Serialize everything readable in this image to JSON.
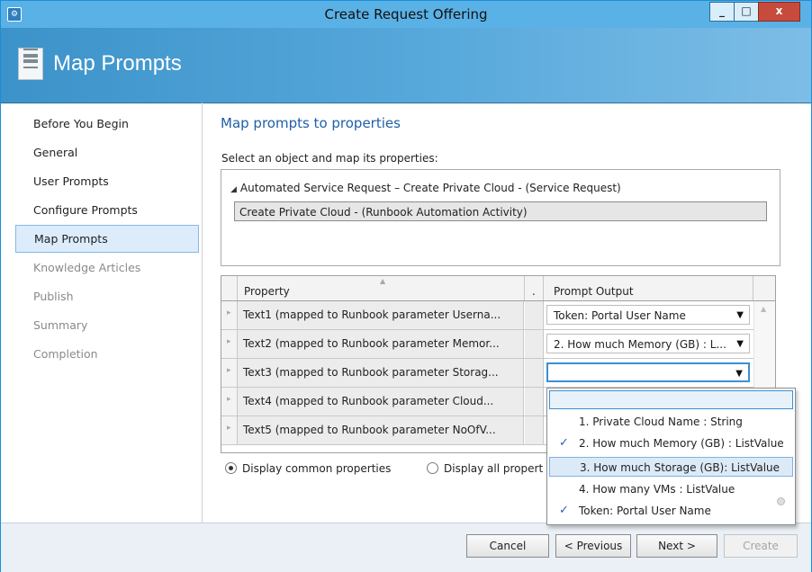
{
  "window": {
    "title": "Create Request Offering",
    "app_icon": "service-manager-icon",
    "controls": {
      "minimize": "_",
      "maximize": "□",
      "close": "x"
    }
  },
  "banner": {
    "title": "Map Prompts",
    "icon": "page-document-icon"
  },
  "nav": {
    "items": [
      {
        "label": "Before You Begin",
        "state": "normal"
      },
      {
        "label": "General",
        "state": "normal"
      },
      {
        "label": "User Prompts",
        "state": "normal"
      },
      {
        "label": "Configure Prompts",
        "state": "normal"
      },
      {
        "label": "Map Prompts",
        "state": "active"
      },
      {
        "label": "Knowledge Articles",
        "state": "disabled"
      },
      {
        "label": "Publish",
        "state": "disabled"
      },
      {
        "label": "Summary",
        "state": "disabled"
      },
      {
        "label": "Completion",
        "state": "disabled"
      }
    ]
  },
  "main": {
    "title": "Map prompts to properties",
    "instruction": "Select an object and map its properties:",
    "tree": {
      "root": "Automated Service Request – Create Private Cloud  - (Service Request)",
      "child": "Create Private Cloud - (Runbook Automation Activity)"
    },
    "grid": {
      "headers": {
        "property": "Property",
        "dot": ".",
        "output": "Prompt Output"
      },
      "rows": [
        {
          "property": "Text1 (mapped to Runbook parameter Userna...",
          "output": "Token: Portal User Name"
        },
        {
          "property": "Text2 (mapped to Runbook parameter Memor...",
          "output": "2. How much Memory (GB) : L..."
        },
        {
          "property": "Text3 (mapped to Runbook parameter Storag...",
          "output": ""
        },
        {
          "property": "Text4 (mapped to Runbook parameter Cloud...",
          "output": ""
        },
        {
          "property": "Text5 (mapped to Runbook parameter NoOfV...",
          "output": ""
        }
      ]
    },
    "radios": {
      "common": "Display common properties",
      "all": "Display all propert",
      "selected": "common"
    },
    "dropdown": {
      "filter_value": "",
      "options": [
        {
          "label": "1. Private Cloud Name : String",
          "checked": false
        },
        {
          "label": "2. How much Memory (GB) : ListValue",
          "checked": true
        },
        {
          "label": "3. How much Storage (GB): ListValue",
          "checked": false
        },
        {
          "label": "4. How many VMs : ListValue",
          "checked": false
        },
        {
          "label": "Token: Portal User Name",
          "checked": true
        }
      ]
    }
  },
  "footer": {
    "cancel": "Cancel",
    "previous": "< Previous",
    "next": "Next >",
    "create": "Create"
  },
  "colors": {
    "accent": "#1f5fa5",
    "banner": "#4a9fd6",
    "selection": "#dcecfb"
  }
}
